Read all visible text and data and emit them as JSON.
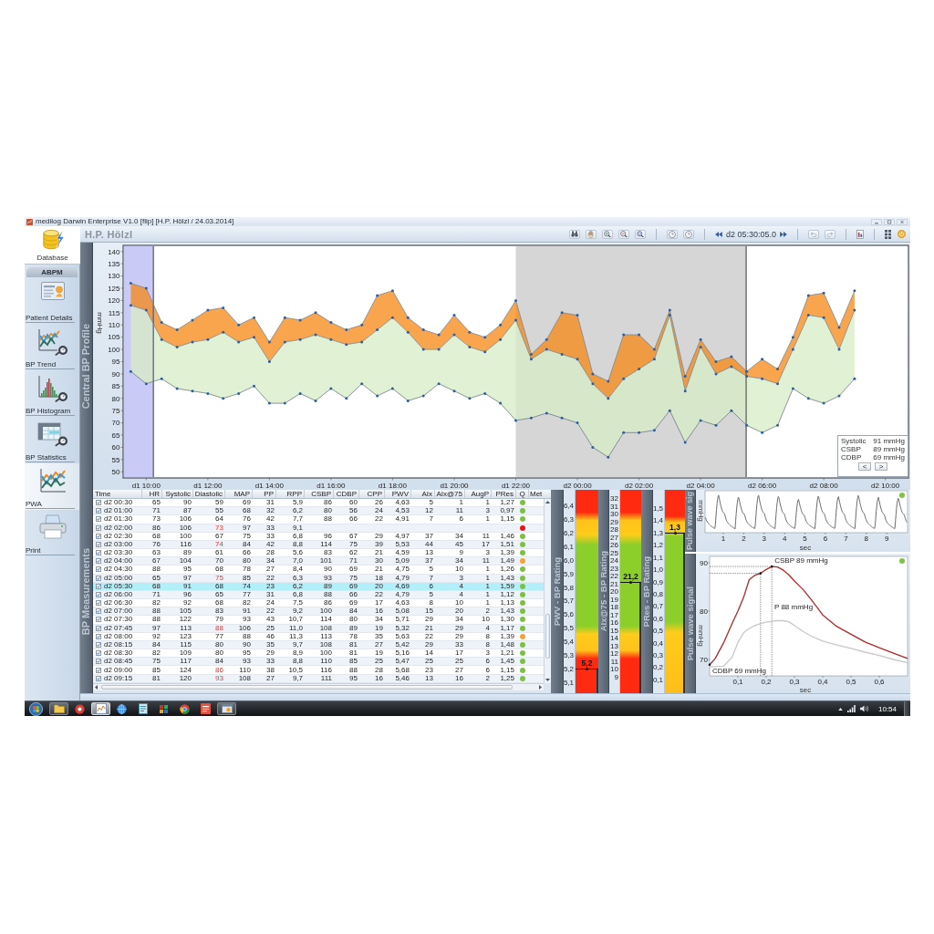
{
  "window": {
    "title": "medilog Darwin Enterprise V1.0 [flip] [H.P. Hölzl / 24.03.2014]"
  },
  "header": {
    "patient": "H.P. Hölzl",
    "tool_groups": [
      [
        {
          "kind": "binoculars"
        },
        {
          "kind": "hand"
        },
        {
          "kind": "zoom_in"
        },
        {
          "kind": "zoom_out"
        },
        {
          "kind": "zoom_reset"
        }
      ],
      [
        {
          "kind": "clock"
        },
        {
          "kind": "clock"
        }
      ]
    ],
    "time": "d2 05:30:05.0",
    "history": [
      {
        "kind": "undo",
        "disabled": true
      },
      {
        "kind": "redo",
        "disabled": true
      }
    ],
    "tools": [
      {
        "kind": "report"
      },
      {
        "kind": "layout"
      },
      {
        "kind": "power"
      }
    ]
  },
  "sidebar": {
    "top_tab": {
      "label": "Database",
      "selected": true
    },
    "section": "ABPM",
    "items": [
      {
        "label": "Patient Details",
        "kind": "card",
        "selected": false
      },
      {
        "label": "BP Trend",
        "kind": "trend",
        "selected": false
      },
      {
        "label": "BP Histogram",
        "kind": "histogram",
        "selected": false
      },
      {
        "label": "BP Statistics",
        "kind": "statistics",
        "selected": false
      },
      {
        "label": "PWA",
        "kind": "wave",
        "selected": true
      },
      {
        "label": "Print",
        "kind": "printer",
        "selected": false
      }
    ]
  },
  "profile": {
    "title": "Central BP Profile",
    "chart_data": {
      "type": "area",
      "ylabel": "mmHg",
      "categories": [
        null,
        "d1 10:00",
        null,
        null,
        null,
        "d1 12:00",
        null,
        null,
        null,
        "d1 14:00",
        null,
        null,
        null,
        "d1 16:00",
        null,
        null,
        null,
        "d1 18:00",
        null,
        null,
        null,
        "d1 20:00",
        null,
        null,
        null,
        "d1 22:00",
        null,
        null,
        null,
        "d2 00:00",
        null,
        null,
        null,
        "d2 02:00",
        null,
        null,
        null,
        "d2 04:00",
        null,
        null,
        null,
        "d2 06:00",
        null,
        null,
        null,
        "d2 08:00",
        null,
        null,
        null,
        "d2 10:00",
        null
      ],
      "series": [
        {
          "name": "Systolic",
          "type": "area",
          "color": "#f8a54e",
          "values": [
            127,
            125,
            111,
            108,
            112,
            116,
            117,
            110,
            113,
            103,
            113,
            112,
            115,
            111,
            108,
            110,
            122,
            124,
            113,
            108,
            106,
            114,
            107,
            105,
            110,
            120,
            98,
            104,
            115,
            114,
            90,
            87,
            106,
            106,
            100,
            116,
            89,
            104,
            95,
            97,
            91,
            96,
            92,
            105,
            122,
            123,
            109,
            124,
            null,
            null,
            null
          ]
        },
        {
          "name": "CSBP",
          "type": "area",
          "color": "#e1f1d3",
          "values": [
            118,
            116,
            104,
            101,
            103,
            104,
            107,
            103,
            105,
            95,
            103,
            104,
            106,
            104,
            102,
            103,
            108,
            113,
            107,
            100,
            100,
            106,
            101,
            99,
            104,
            112,
            96,
            100,
            98,
            96,
            86,
            80,
            88,
            92,
            96,
            114,
            83,
            101,
            90,
            93,
            89,
            88,
            86,
            100,
            114,
            113,
            100,
            116,
            null,
            null,
            null
          ]
        },
        {
          "name": "CDBP",
          "type": "line",
          "color": "#6f7a86",
          "values": [
            91,
            86,
            88,
            84,
            83,
            82,
            80,
            82,
            85,
            78,
            78,
            82,
            79,
            84,
            80,
            86,
            81,
            84,
            79,
            81,
            86,
            83,
            80,
            82,
            78,
            71,
            72,
            74,
            72,
            70,
            60,
            56,
            66,
            66,
            67,
            75,
            62,
            71,
            69,
            75,
            69,
            66,
            69,
            84,
            80,
            78,
            81,
            88,
            null,
            null,
            null
          ]
        }
      ],
      "ylim": [
        47.5,
        142.5
      ],
      "yticks": [
        50,
        55,
        60,
        65,
        70,
        75,
        80,
        85,
        90,
        95,
        100,
        105,
        110,
        115,
        120,
        125,
        130,
        135,
        140
      ]
    },
    "readout": [
      "91 mmHg",
      "89 mmHg",
      "69 mmHg"
    ],
    "readout_buttons": [
      "<",
      ">"
    ]
  },
  "measurements": {
    "title": "BP Measurements",
    "columns": [
      "Time",
      "HR",
      "Systolic",
      "Diastolic",
      "MAP",
      "PP",
      "RPP",
      "CSBP",
      "CDBP",
      "CPP",
      "PWV",
      "AIx",
      "AIx@75",
      "AugP",
      "PRes",
      "Q",
      "Met"
    ],
    "rows": [
      {
        "time": "d2 00:30",
        "checked": true,
        "selected": false,
        "values": [
          "65",
          "90",
          "59",
          "69",
          "31",
          "5,9",
          "86",
          "60",
          "26",
          "4,63",
          "5",
          "1",
          "1",
          "1,27"
        ],
        "diastolic_high": false,
        "color": "#7cc242"
      },
      {
        "time": "d2 01:00",
        "checked": true,
        "selected": false,
        "values": [
          "71",
          "87",
          "55",
          "68",
          "32",
          "6,2",
          "80",
          "56",
          "24",
          "4,53",
          "12",
          "11",
          "3",
          "0,97"
        ],
        "diastolic_high": false,
        "color": "#7cc242"
      },
      {
        "time": "d2 01:30",
        "checked": true,
        "selected": false,
        "values": [
          "73",
          "106",
          "64",
          "76",
          "42",
          "7,7",
          "88",
          "66",
          "22",
          "4,91",
          "7",
          "6",
          "1",
          "1,15"
        ],
        "diastolic_high": false,
        "color": "#7cc242"
      },
      {
        "time": "d2 02:00",
        "checked": true,
        "selected": false,
        "values": [
          "86",
          "106",
          "73",
          "97",
          "33",
          "9,1"
        ],
        "diastolic_high": true,
        "color": "#e8141b"
      },
      {
        "time": "d2 02:30",
        "checked": true,
        "selected": false,
        "values": [
          "68",
          "100",
          "67",
          "75",
          "33",
          "6,8",
          "96",
          "67",
          "29",
          "4,97",
          "37",
          "34",
          "11",
          "1,46"
        ],
        "diastolic_high": false,
        "color": "#7cc242"
      },
      {
        "time": "d2 03:00",
        "checked": true,
        "selected": false,
        "values": [
          "76",
          "116",
          "74",
          "84",
          "42",
          "8,8",
          "114",
          "75",
          "39",
          "5,53",
          "44",
          "45",
          "17",
          "1,51"
        ],
        "diastolic_high": true,
        "color": "#7cc242"
      },
      {
        "time": "d2 03:30",
        "checked": true,
        "selected": false,
        "values": [
          "63",
          "89",
          "61",
          "66",
          "28",
          "5,6",
          "83",
          "62",
          "21",
          "4,59",
          "13",
          "9",
          "3",
          "1,39"
        ],
        "diastolic_high": false,
        "color": "#7cc242"
      },
      {
        "time": "d2 04:00",
        "checked": true,
        "selected": false,
        "values": [
          "67",
          "104",
          "70",
          "80",
          "34",
          "7,0",
          "101",
          "71",
          "30",
          "5,09",
          "37",
          "34",
          "11",
          "1,49"
        ],
        "diastolic_high": false,
        "color": "#f7a13a"
      },
      {
        "time": "d2 04:30",
        "checked": true,
        "selected": false,
        "values": [
          "88",
          "95",
          "68",
          "78",
          "27",
          "8,4",
          "90",
          "69",
          "21",
          "4,75",
          "5",
          "10",
          "1",
          "1,26"
        ],
        "diastolic_high": false,
        "color": "#7cc242"
      },
      {
        "time": "d2 05:00",
        "checked": true,
        "selected": false,
        "values": [
          "65",
          "97",
          "75",
          "85",
          "22",
          "6,3",
          "93",
          "75",
          "18",
          "4,79",
          "7",
          "3",
          "1",
          "1,43"
        ],
        "diastolic_high": true,
        "color": "#7cc242"
      },
      {
        "time": "d2 05:30",
        "checked": true,
        "selected": true,
        "values": [
          "68",
          "91",
          "68",
          "74",
          "23",
          "6,2",
          "89",
          "69",
          "20",
          "4,69",
          "6",
          "4",
          "1",
          "1,59"
        ],
        "diastolic_high": false,
        "color": "#7cc242"
      },
      {
        "time": "d2 06:00",
        "checked": true,
        "selected": false,
        "values": [
          "71",
          "96",
          "65",
          "77",
          "31",
          "6,8",
          "88",
          "66",
          "22",
          "4,79",
          "5",
          "4",
          "1",
          "1,12"
        ],
        "diastolic_high": false,
        "color": "#7cc242"
      },
      {
        "time": "d2 06:30",
        "checked": true,
        "selected": false,
        "values": [
          "82",
          "92",
          "68",
          "82",
          "24",
          "7,5",
          "86",
          "69",
          "17",
          "4,63",
          "8",
          "10",
          "1",
          "1,13"
        ],
        "diastolic_high": false,
        "color": "#7cc242"
      },
      {
        "time": "d2 07:00",
        "checked": true,
        "selected": false,
        "values": [
          "88",
          "105",
          "83",
          "91",
          "22",
          "9,2",
          "100",
          "84",
          "16",
          "5,08",
          "15",
          "20",
          "2",
          "1,43"
        ],
        "diastolic_high": false,
        "color": "#7cc242"
      },
      {
        "time": "d2 07:30",
        "checked": true,
        "selected": false,
        "values": [
          "88",
          "122",
          "79",
          "93",
          "43",
          "10,7",
          "114",
          "80",
          "34",
          "5,71",
          "29",
          "34",
          "10",
          "1,30"
        ],
        "diastolic_high": false,
        "color": "#7cc242"
      },
      {
        "time": "d2 07:45",
        "checked": true,
        "selected": false,
        "values": [
          "97",
          "113",
          "88",
          "106",
          "25",
          "11,0",
          "108",
          "89",
          "19",
          "5,32",
          "21",
          "29",
          "4",
          "1,17"
        ],
        "diastolic_high": true,
        "color": "#7cc242"
      },
      {
        "time": "d2 08:00",
        "checked": true,
        "selected": false,
        "values": [
          "92",
          "123",
          "77",
          "88",
          "46",
          "11,3",
          "113",
          "78",
          "35",
          "5,63",
          "22",
          "29",
          "8",
          "1,39"
        ],
        "diastolic_high": false,
        "color": "#f7a13a"
      },
      {
        "time": "d2 08:15",
        "checked": true,
        "selected": false,
        "values": [
          "84",
          "115",
          "80",
          "90",
          "35",
          "9,7",
          "108",
          "81",
          "27",
          "5,42",
          "29",
          "33",
          "8",
          "1,48"
        ],
        "diastolic_high": false,
        "color": "#7cc242"
      },
      {
        "time": "d2 08:30",
        "checked": true,
        "selected": false,
        "values": [
          "82",
          "109",
          "80",
          "95",
          "29",
          "8,9",
          "100",
          "81",
          "19",
          "5,16",
          "14",
          "17",
          "3",
          "1,21"
        ],
        "diastolic_high": false,
        "color": "#7cc242"
      },
      {
        "time": "d2 08:45",
        "checked": true,
        "selected": false,
        "values": [
          "75",
          "117",
          "84",
          "93",
          "33",
          "8,8",
          "110",
          "85",
          "25",
          "5,47",
          "25",
          "25",
          "6",
          "1,45"
        ],
        "diastolic_high": false,
        "color": "#7cc242"
      },
      {
        "time": "d2 09:00",
        "checked": true,
        "selected": false,
        "values": [
          "85",
          "124",
          "86",
          "110",
          "38",
          "10,5",
          "116",
          "88",
          "28",
          "5,68",
          "23",
          "27",
          "6",
          "1,15"
        ],
        "diastolic_high": true,
        "color": "#7cc242"
      },
      {
        "time": "d2 09:15",
        "checked": true,
        "selected": false,
        "values": [
          "81",
          "120",
          "93",
          "108",
          "27",
          "9,7",
          "111",
          "95",
          "16",
          "5,46",
          "13",
          "16",
          "2",
          "1,25"
        ],
        "diastolic_high": true,
        "color": "#7cc242"
      }
    ]
  },
  "ratings": [
    {
      "title": "PWV - BP Rating",
      "kind": "two_sided",
      "ticks": [
        "6,4",
        "6,3",
        "6,2",
        "6,1",
        "6,0",
        "5,9",
        "5,8",
        "5,7",
        "5,6",
        "5,5",
        "5,4",
        "5,3",
        "5,2",
        "5,1"
      ],
      "reading": "5,2",
      "level": 0.117
    },
    {
      "title": "AIx@75 - BP Rating",
      "kind": "two_sided",
      "ticks": [
        "32",
        "31",
        "30",
        "29",
        "28",
        "27",
        "26",
        "25",
        "24",
        "23",
        "22",
        "21",
        "20",
        "19",
        "18",
        "17",
        "16",
        "15",
        "14",
        "13",
        "12",
        "11",
        "10",
        "9"
      ],
      "reading": "21,2",
      "level": 0.543
    },
    {
      "title": "PRes - BP Rating",
      "kind": "upper",
      "ticks": [
        "1,5",
        "1,4",
        "1,3",
        "1,2",
        "1,1",
        "1,0",
        "0,9",
        "0,8",
        "0,7",
        "0,6",
        "0,5",
        "0,4",
        "0,3",
        "0,2",
        "0,1"
      ],
      "reading": "1,3",
      "level": 0.785
    }
  ],
  "pulse": {
    "top": {
      "title": "Pulse wave sig",
      "xticks": [
        "1",
        "2",
        "3",
        "4",
        "5",
        "6",
        "7",
        "8",
        "9"
      ],
      "xlabel": "sec",
      "ylabel": "mmHg",
      "color": "#80c342"
    },
    "bottom": {
      "title": "Pulse wave signal",
      "color": "#80c342",
      "chart_data": {
        "type": "line",
        "xlabel": "sec",
        "ylabel": "mmHg",
        "x": [
          0,
          0.02,
          0.05,
          0.08,
          0.1,
          0.12,
          0.14,
          0.16,
          0.18,
          0.2,
          0.22,
          0.24,
          0.26,
          0.28,
          0.3,
          0.33,
          0.36,
          0.4,
          0.45,
          0.5,
          0.55,
          0.6,
          0.65,
          0.7
        ],
        "series": [
          {
            "color": "#b0282a",
            "values": [
              68.9,
              70.2,
              73.5,
              77.5,
              80,
              82.8,
              86.5,
              87.4,
              87.8,
              88.6,
              89.2,
              89.1,
              88.5,
              87.5,
              86.2,
              84.5,
              82.3,
              79.2,
              76.8,
              75.2,
              73.6,
              72.4,
              71.3,
              70.2
            ]
          },
          {
            "color": "#c8c8c8",
            "values": [
              68.5,
              68.5,
              68.6,
              70.5,
              73.5,
              75.5,
              76.4,
              77,
              77.4,
              77.7,
              77.9,
              78,
              78,
              77.8,
              77,
              75.8,
              74.8,
              73.8,
              73,
              72.3,
              71.5,
              70.8,
              70,
              69.3
            ]
          }
        ],
        "xlim": [
          0,
          0.7
        ],
        "ylim": [
          66.6,
          91.3
        ],
        "xticks": [
          {
            "value": 0.1,
            "label": "0,1"
          },
          {
            "value": 0.2,
            "label": "0,2"
          },
          {
            "value": 0.3,
            "label": "0,3"
          },
          {
            "value": 0.4,
            "label": "0,4"
          },
          {
            "value": 0.5,
            "label": "0,5"
          },
          {
            "value": 0.6,
            "label": "0,6"
          }
        ],
        "yticks": [
          70,
          80,
          90
        ],
        "ref_lines": [
          {
            "axis": "x",
            "value": 0.22
          },
          {
            "axis": "y",
            "value": 89.2
          },
          {
            "axis": "x",
            "value": 0.18
          },
          {
            "axis": "y",
            "value": 87.8
          }
        ],
        "annotations": [
          {
            "text": "CSBP 89 mmHg",
            "x": 0.22,
            "y": 89.2
          },
          "P 88 mmHg",
          {
            "text": "CDBP 69 mmHg",
            "x": 0,
            "y": 68.9
          }
        ]
      }
    }
  },
  "taskbar": {
    "apps": [
      {
        "kind": "folder",
        "running": true,
        "active": false
      },
      {
        "kind": "ring",
        "running": false,
        "active": false
      },
      {
        "kind": "chart",
        "running": true,
        "active": true
      },
      {
        "kind": "globe",
        "running": false,
        "active": false
      },
      {
        "kind": "page",
        "running": false,
        "active": false
      },
      {
        "kind": "tiles",
        "running": false,
        "active": false
      },
      {
        "kind": "wheel",
        "running": false,
        "active": false
      },
      {
        "kind": "document",
        "running": false,
        "active": false
      },
      {
        "kind": "window",
        "running": true,
        "active": false
      }
    ],
    "time": "10:54"
  }
}
